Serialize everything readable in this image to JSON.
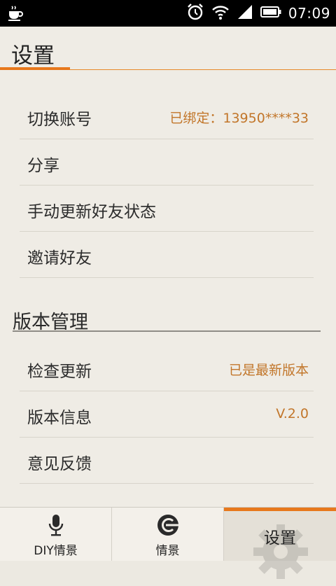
{
  "status_bar": {
    "time": "07:09",
    "icons": [
      "coffee-icon",
      "alarm-icon",
      "wifi-icon",
      "signal-icon",
      "battery-icon"
    ]
  },
  "header": {
    "title": "设置"
  },
  "account_section": {
    "items": [
      {
        "label": "切换账号",
        "value": "已绑定：13950****33"
      },
      {
        "label": "分享",
        "value": ""
      },
      {
        "label": "手动更新好友状态",
        "value": ""
      },
      {
        "label": "邀请好友",
        "value": ""
      }
    ]
  },
  "version_section": {
    "title": "版本管理",
    "items": [
      {
        "label": "检查更新",
        "value": "已是最新版本"
      },
      {
        "label": "版本信息",
        "value": "V.2.0"
      },
      {
        "label": "意见反馈",
        "value": ""
      }
    ]
  },
  "tabs": [
    {
      "label": "DIY情景",
      "icon": "microphone-icon",
      "selected": false
    },
    {
      "label": "情景",
      "icon": "scene-icon",
      "selected": false
    },
    {
      "label": "设置",
      "icon": "gear-icon",
      "selected": true
    }
  ],
  "colors": {
    "accent": "#e7781c",
    "value_text": "#c2762a",
    "background": "#efece5"
  }
}
